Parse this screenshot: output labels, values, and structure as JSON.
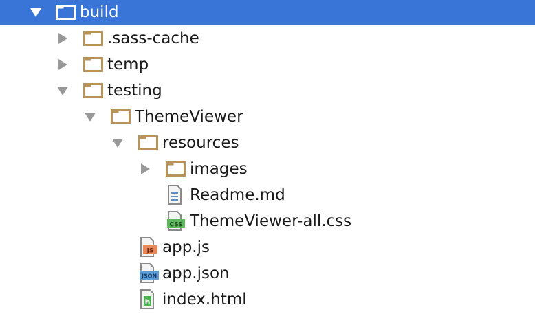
{
  "colors": {
    "selection": "#3875d7",
    "folder": "#b8935a",
    "arrow": "#999999",
    "css_badge": "#5fb85f",
    "js_badge": "#e8875a",
    "json_badge": "#5b9bd5",
    "html_badge": "#4caf50"
  },
  "tree": {
    "build": {
      "label": "build",
      "icon": "folder-icon",
      "expanded": true,
      "selected": true
    },
    "sass_cache": {
      "label": ".sass-cache",
      "icon": "folder-icon",
      "expanded": false
    },
    "temp": {
      "label": "temp",
      "icon": "folder-icon",
      "expanded": false
    },
    "testing": {
      "label": "testing",
      "icon": "folder-icon",
      "expanded": true
    },
    "themeviewer": {
      "label": "ThemeViewer",
      "icon": "folder-icon",
      "expanded": true
    },
    "resources": {
      "label": "resources",
      "icon": "folder-icon",
      "expanded": true
    },
    "images": {
      "label": "images",
      "icon": "folder-icon",
      "expanded": false
    },
    "readme": {
      "label": "Readme.md",
      "icon": "text-file-icon"
    },
    "themeviewer_css": {
      "label": "ThemeViewer-all.css",
      "icon": "css-file-icon",
      "badge": "CSS"
    },
    "app_js": {
      "label": "app.js",
      "icon": "js-file-icon",
      "badge": "JS"
    },
    "app_json": {
      "label": "app.json",
      "icon": "json-file-icon",
      "badge": "JSON"
    },
    "index_html": {
      "label": "index.html",
      "icon": "html-file-icon",
      "badge": "h"
    }
  }
}
